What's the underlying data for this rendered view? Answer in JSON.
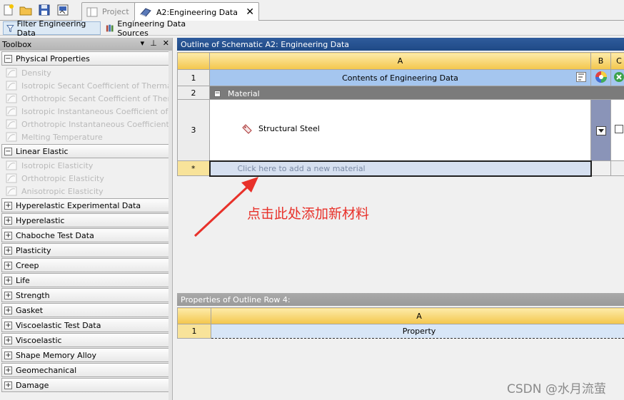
{
  "tabbar": {
    "tabs": [
      {
        "label": "Project",
        "active": false
      },
      {
        "label": "A2:Engineering Data",
        "active": true
      }
    ],
    "close_label": "✕"
  },
  "toolbar": {
    "filter_label": "Filter Engineering Data",
    "sources_label": "Engineering Data Sources"
  },
  "toolbox": {
    "title": "Toolbox",
    "controls": [
      "▾",
      "⊥",
      "✕"
    ],
    "physical_group": {
      "label": "Physical Properties",
      "expander": "−",
      "items": [
        "Density",
        "Isotropic Secant Coefficient of Thermal E",
        "Orthotropic Secant Coefficient of Therma",
        "Isotropic Instantaneous Coefficient of Th",
        "Orthotropic Instantaneous Coefficient of",
        "Melting Temperature"
      ]
    },
    "linear_group": {
      "label": "Linear Elastic",
      "expander": "−",
      "items": [
        "Isotropic Elasticity",
        "Orthotropic Elasticity",
        "Anisotropic Elasticity"
      ]
    },
    "collapsed_groups": [
      "Hyperelastic Experimental Data",
      "Hyperelastic",
      "Chaboche Test Data",
      "Plasticity",
      "Creep",
      "Life",
      "Strength",
      "Gasket",
      "Viscoelastic Test Data",
      "Viscoelastic",
      "Shape Memory Alloy",
      "Geomechanical",
      "Damage"
    ],
    "expander_plus": "+"
  },
  "outline": {
    "title": "Outline of Schematic A2: Engineering Data",
    "col_headers": [
      "A",
      "B",
      "C"
    ],
    "rows": [
      {
        "num": "1",
        "text": "Contents of Engineering Data"
      },
      {
        "num": "2",
        "text": "Material",
        "expander": "−"
      },
      {
        "num": "3",
        "text": "Structural Steel"
      },
      {
        "num": "*",
        "text": "Click here to add a new material"
      }
    ]
  },
  "annotation": "点击此处添加新材料",
  "properties": {
    "title": "Properties of Outline Row 4:",
    "col_header": "A",
    "row_num": "1",
    "row_text": "Property"
  },
  "watermark": "CSDN @水月流萤",
  "colors": {
    "annotation": "#e8312a",
    "title_blue": "#2f5c9c",
    "header_gold": "#f3c64c",
    "contents_blue": "#a5c6ef"
  }
}
